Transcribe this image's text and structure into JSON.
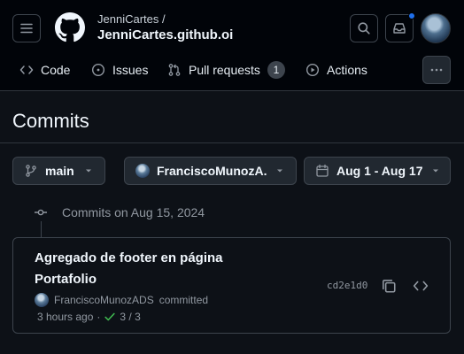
{
  "header": {
    "owner": "JenniCartes /",
    "repo": "JenniCartes.github.oi"
  },
  "tabs": [
    {
      "label": "Code",
      "icon": "code-icon"
    },
    {
      "label": "Issues",
      "icon": "issue-opened-icon"
    },
    {
      "label": "Pull requests",
      "icon": "git-pull-request-icon",
      "count": "1"
    },
    {
      "label": "Actions",
      "icon": "play-icon"
    }
  ],
  "page": {
    "title": "Commits"
  },
  "filters": {
    "branch": "main",
    "author": "FranciscoMunozA...",
    "date_range": "Aug 1 - Aug 17"
  },
  "commits_group": {
    "heading": "Commits on Aug 15, 2024",
    "commits": [
      {
        "title": "Agregado de footer en página Portafolio",
        "author": "FranciscoMunozADS",
        "action": "committed",
        "time": "3 hours ago",
        "separator": "·",
        "checks": "3 / 3",
        "sha": "cd2e1d0"
      }
    ]
  },
  "colors": {
    "background": "#0d1117",
    "header_background": "#010409",
    "border": "#3d444d",
    "text": "#e6edf3",
    "muted": "#9198a1",
    "success": "#3fb950",
    "accent": "#1f6feb"
  }
}
